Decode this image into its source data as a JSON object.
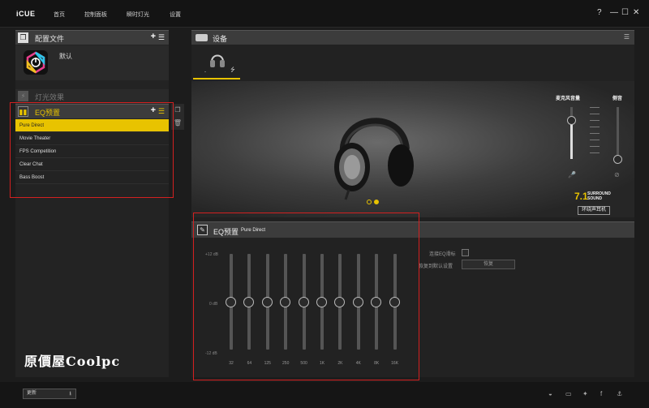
{
  "app": {
    "brand": "iCUE",
    "nav": [
      "首页",
      "控制面板",
      "瞬时灯光",
      "设置"
    ],
    "window_controls": {
      "help": "?",
      "minimize": "—",
      "maximize": "☐",
      "close": "✕"
    }
  },
  "left": {
    "profiles_title": "配置文件",
    "profile_name": "默认",
    "lighting_title": "灯光效果",
    "eq_title": "EQ预置",
    "presets": [
      {
        "label": "Pure Direct",
        "selected": true
      },
      {
        "label": "Movie Theater",
        "selected": false
      },
      {
        "label": "FPS Competition",
        "selected": false
      },
      {
        "label": "Clear Chat",
        "selected": false
      },
      {
        "label": "Bass Boost",
        "selected": false
      }
    ]
  },
  "device": {
    "title": "设备",
    "mic_volume_label": "麦克风音量",
    "sidetone_label": "侧音",
    "mic_volume_level": 0.75,
    "sidetone_level": 0.0,
    "surround_number": "7.1",
    "surround_text_1": "SURROUND",
    "surround_text_2": "SOUND",
    "surround_label": "环绕声耳机",
    "carousel_active": 1,
    "carousel_count": 2
  },
  "eq": {
    "title": "EQ预置",
    "preset_name": "Pure Direct",
    "db_top": "+12 dB",
    "db_mid": "0 dB",
    "db_bottom": "-12 dB",
    "bands": [
      "32",
      "64",
      "125",
      "250",
      "500",
      "1K",
      "2K",
      "4K",
      "8K",
      "16K"
    ],
    "band_gains_db": [
      0,
      0,
      0,
      0,
      0,
      0,
      0,
      0,
      0,
      0
    ],
    "sliders_option_label": "连接EQ滑标",
    "restore_label": "恢复到默认设置",
    "restore_button": "恢复"
  },
  "bottom": {
    "update_label": "更新",
    "social_icons": [
      "reddit-icon",
      "chat-icon",
      "twitter-icon",
      "facebook-icon",
      "corsair-icon"
    ]
  },
  "watermark": "原價屋Coolpc",
  "colors": {
    "accent": "#e8c300",
    "highlight_box": "#d32020"
  }
}
